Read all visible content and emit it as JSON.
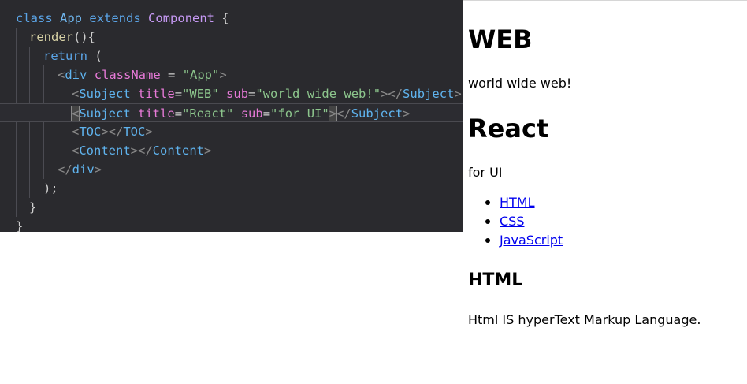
{
  "editor": {
    "lines": [
      [
        {
          "t": "class",
          "c": "kw"
        },
        {
          "t": " "
        },
        {
          "t": "App",
          "c": "cls"
        },
        {
          "t": " "
        },
        {
          "t": "extends",
          "c": "kw"
        },
        {
          "t": " "
        },
        {
          "t": "Component",
          "c": "comp"
        },
        {
          "t": " {",
          "c": "plain"
        }
      ],
      [
        {
          "t": "render",
          "c": "fn"
        },
        {
          "t": "(){",
          "c": "plain"
        }
      ],
      [
        {
          "t": "return",
          "c": "kw"
        },
        {
          "t": " (",
          "c": "plain"
        }
      ],
      [
        {
          "t": "<",
          "c": "bracket"
        },
        {
          "t": "div",
          "c": "tag"
        },
        {
          "t": " "
        },
        {
          "t": "className",
          "c": "attr"
        },
        {
          "t": " = ",
          "c": "plain"
        },
        {
          "t": "\"App\"",
          "c": "str"
        },
        {
          "t": ">",
          "c": "bracket"
        }
      ],
      [
        {
          "t": "<",
          "c": "bracket"
        },
        {
          "t": "Subject",
          "c": "tag"
        },
        {
          "t": " "
        },
        {
          "t": "title",
          "c": "attr"
        },
        {
          "t": "=",
          "c": "plain"
        },
        {
          "t": "\"WEB\"",
          "c": "str"
        },
        {
          "t": " "
        },
        {
          "t": "sub",
          "c": "attr"
        },
        {
          "t": "=",
          "c": "plain"
        },
        {
          "t": "\"world wide web!\"",
          "c": "str"
        },
        {
          "t": "></",
          "c": "bracket"
        },
        {
          "t": "Subject",
          "c": "tag"
        },
        {
          "t": ">",
          "c": "bracket"
        }
      ],
      [
        {
          "t": "<",
          "c": "bracket cursor-box"
        },
        {
          "t": "Subject",
          "c": "tag"
        },
        {
          "t": " "
        },
        {
          "t": "title",
          "c": "attr"
        },
        {
          "t": "=",
          "c": "plain"
        },
        {
          "t": "\"React\"",
          "c": "str"
        },
        {
          "t": " "
        },
        {
          "t": "sub",
          "c": "attr"
        },
        {
          "t": "=",
          "c": "plain"
        },
        {
          "t": "\"for UI\"",
          "c": "str"
        },
        {
          "t": ">",
          "c": "bracket cursor-box"
        },
        {
          "t": "</",
          "c": "bracket"
        },
        {
          "t": "Subject",
          "c": "tag"
        },
        {
          "t": ">",
          "c": "bracket"
        }
      ],
      [
        {
          "t": "<",
          "c": "bracket"
        },
        {
          "t": "TOC",
          "c": "tag"
        },
        {
          "t": "></",
          "c": "bracket"
        },
        {
          "t": "TOC",
          "c": "tag"
        },
        {
          "t": ">",
          "c": "bracket"
        }
      ],
      [
        {
          "t": "<",
          "c": "bracket"
        },
        {
          "t": "Content",
          "c": "tag"
        },
        {
          "t": "></",
          "c": "bracket"
        },
        {
          "t": "Content",
          "c": "tag"
        },
        {
          "t": ">",
          "c": "bracket"
        }
      ],
      [
        {
          "t": "</",
          "c": "bracket"
        },
        {
          "t": "div",
          "c": "tag"
        },
        {
          "t": ">",
          "c": "bracket"
        }
      ],
      [
        {
          "t": ");",
          "c": "plain"
        }
      ],
      [
        {
          "t": "}",
          "c": "plain"
        }
      ],
      [
        {
          "t": "}",
          "c": "plain"
        }
      ]
    ]
  },
  "preview": {
    "subject1": {
      "title": "WEB",
      "sub": "world wide web!"
    },
    "subject2": {
      "title": "React",
      "sub": "for UI"
    },
    "toc": [
      "HTML",
      "CSS",
      "JavaScript"
    ],
    "content": {
      "title": "HTML",
      "desc": "Html IS hyperText Markup Language."
    }
  },
  "colors": {
    "editor_bg": "#2a2a2e",
    "link": "#0000ee"
  }
}
